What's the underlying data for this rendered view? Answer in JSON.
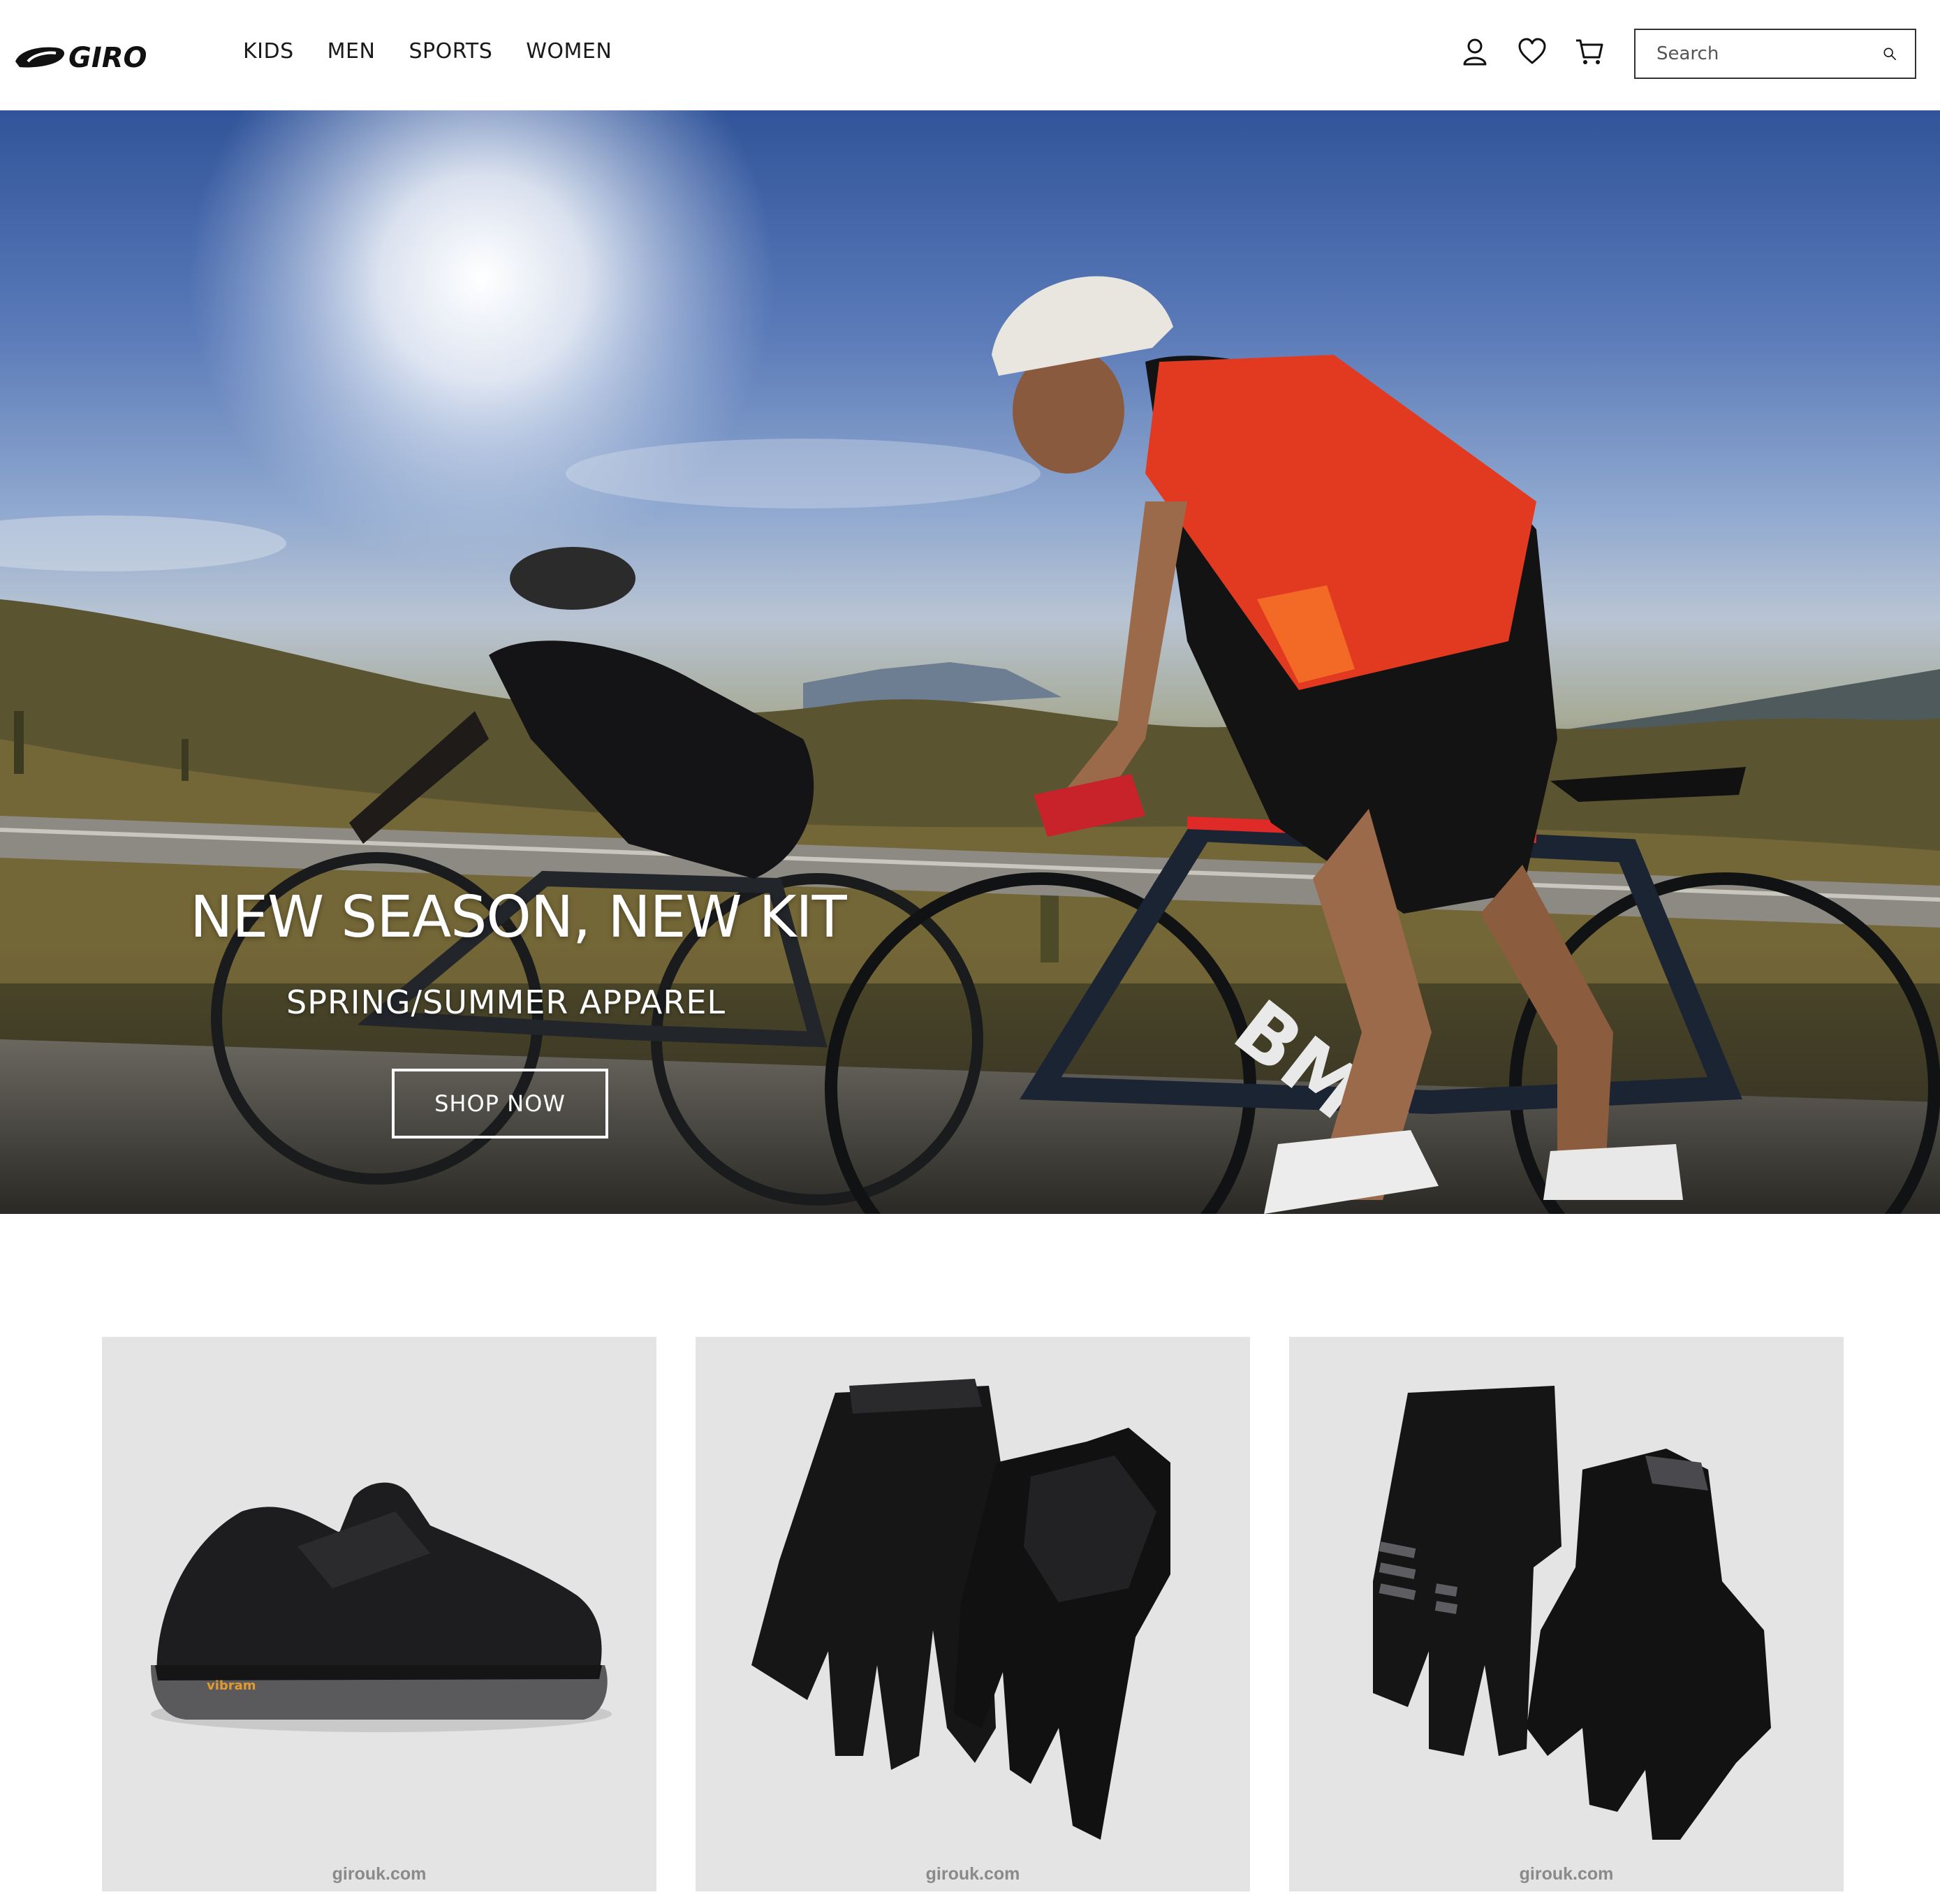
{
  "header": {
    "logo_text": "GIRO",
    "nav": [
      {
        "label": "KIDS"
      },
      {
        "label": "MEN"
      },
      {
        "label": "SPORTS"
      },
      {
        "label": "WOMEN"
      }
    ],
    "icons": [
      "account-icon",
      "wishlist-heart-icon",
      "cart-icon"
    ],
    "search": {
      "placeholder": "Search",
      "icon": "search-icon"
    }
  },
  "hero": {
    "title": "NEW SEASON, NEW KIT",
    "subtitle": "SPRING/SUMMER APPAREL",
    "cta_label": "SHOP NOW",
    "bike_brand_text": "BMC",
    "image_description_colors": {
      "sky": "#31549a",
      "vest": "#e03a22",
      "ground": "#4b4628"
    }
  },
  "products": [
    {
      "image": "black-cycling-shoe",
      "watermark": "girouk.com"
    },
    {
      "image": "black-full-finger-gloves",
      "watermark": "girouk.com"
    },
    {
      "image": "black-grey-mtb-gloves",
      "watermark": "girouk.com"
    }
  ],
  "colors": {
    "text": "#1a1a1a",
    "card_bg": "#e4e4e4",
    "watermark": "#8a8a8a"
  }
}
